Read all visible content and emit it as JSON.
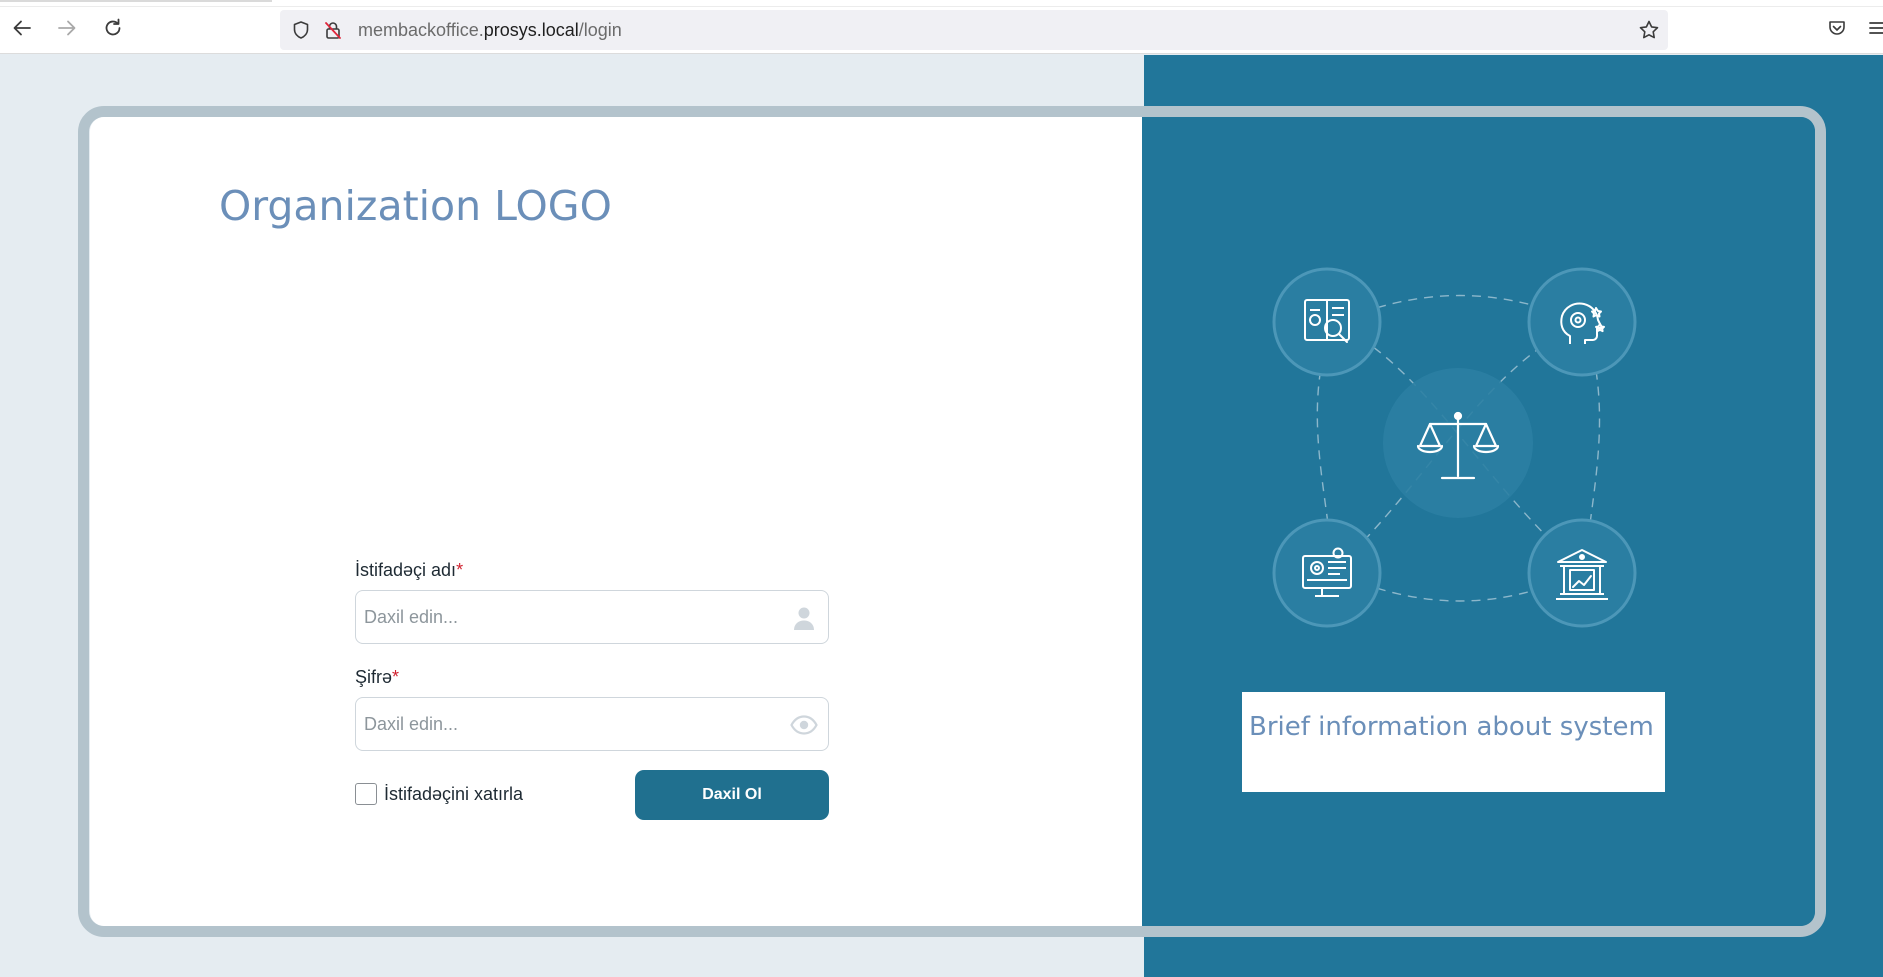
{
  "browser": {
    "url_prefix": "membackoffice.",
    "url_domain": "prosys.local",
    "url_path": "/login",
    "icons": [
      "back-arrow-icon",
      "forward-arrow-icon",
      "reload-icon",
      "shield-icon",
      "insecure-lock-icon",
      "bookmark-star-icon",
      "pocket-icon",
      "menu-icon"
    ]
  },
  "left": {
    "logo_text": "Organization LOGO",
    "username": {
      "label": "İstifadəçi adı",
      "required_mark": "*",
      "placeholder": "Daxil edin...",
      "icon": "user-icon"
    },
    "password": {
      "label": "Şifrə",
      "required_mark": "*",
      "placeholder": "Daxil edin...",
      "icon": "eye-icon"
    },
    "remember_label": "İstifadəçini xatırla",
    "login_button": "Daxil Ol"
  },
  "right": {
    "info_text": "Brief information about system",
    "illustration_icons": [
      "book-gear-icon",
      "head-gear-icon",
      "scales-of-justice-icon",
      "monitor-gear-icon",
      "bank-chart-icon"
    ]
  },
  "colors": {
    "brand_blue": "#21769a",
    "button_blue": "#20708f",
    "logo_text": "#6b8fb9",
    "required": "#d0212f",
    "frame": "#b3c3cc",
    "page_bg": "#e5ecf1"
  }
}
